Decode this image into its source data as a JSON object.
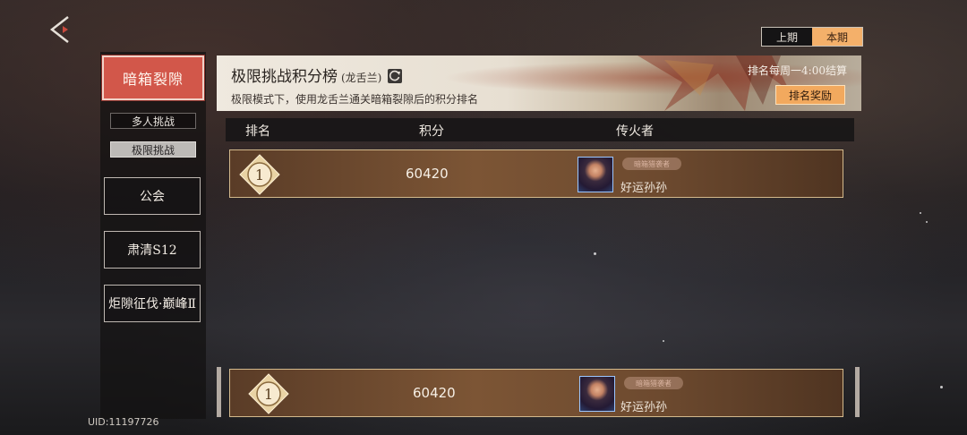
{
  "nav": {
    "back_icon": "back-arrow-icon"
  },
  "sidebar": {
    "primary": "暗箱裂隙",
    "sub_items": [
      "多人挑战",
      "极限挑战"
    ],
    "active_sub": "极限挑战",
    "buttons": [
      "公会",
      "肃清S12",
      "炬隙征伐·巅峰Ⅱ"
    ]
  },
  "uid": "UID:11197726",
  "period": {
    "prev": "上期",
    "current": "本期"
  },
  "banner": {
    "title": "极限挑战积分榜",
    "subtitle": "(龙舌兰)",
    "refresh_icon": "refresh-icon",
    "description": "极限模式下，使用龙舌兰通关暗箱裂隙后的积分排名",
    "reset_text": "排名每周一4:00结算",
    "reward_button": "排名奖励"
  },
  "table": {
    "headers": [
      "排名",
      "积分",
      "传火者"
    ],
    "rows": [
      {
        "rank": "1",
        "score": "60420",
        "title_tag": "暗箱猎袭者",
        "name": "好运孙孙"
      }
    ]
  },
  "self_row": {
    "rank": "1",
    "score": "60420",
    "title_tag": "暗箱猎袭者",
    "name": "好运孙孙"
  },
  "colors": {
    "accent_red": "#d2574a",
    "accent_orange": "#f2a95e",
    "row_brown": "#7c5535"
  }
}
